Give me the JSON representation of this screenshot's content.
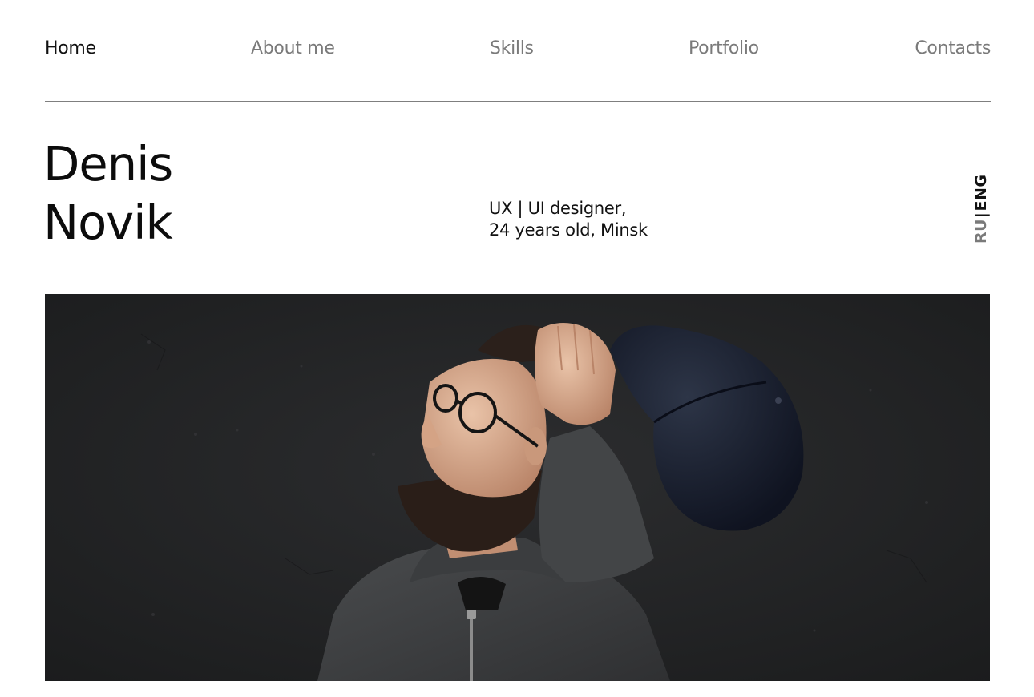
{
  "nav": {
    "items": [
      {
        "label": "Home",
        "active": true
      },
      {
        "label": "About me",
        "active": false
      },
      {
        "label": "Skills",
        "active": false
      },
      {
        "label": "Portfolio",
        "active": false
      },
      {
        "label": "Contacts",
        "active": false
      }
    ]
  },
  "hero": {
    "first_name": "Denis",
    "last_name": "Novik",
    "tagline_line1": "UX | UI designer,",
    "tagline_line2": "24 years old, Minsk"
  },
  "language": {
    "ru": "RU",
    "separator": "|",
    "eng": "ENG",
    "active": "ENG"
  },
  "photo": {
    "subject": "portrait-photo"
  },
  "colors": {
    "text_active": "#111111",
    "text_muted": "#7a7a7a",
    "divider": "#7f7f7f",
    "photo_background": "#232425"
  }
}
